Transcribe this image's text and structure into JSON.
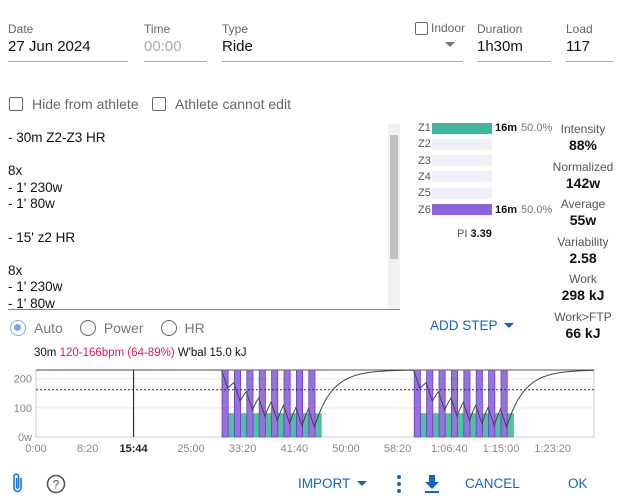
{
  "form": {
    "date": {
      "label": "Date",
      "value": "27 Jun 2024"
    },
    "time": {
      "label": "Time",
      "value": "00:00"
    },
    "type": {
      "label": "Type",
      "value": "Ride"
    },
    "indoor": {
      "label": "Indoor",
      "checked": false
    },
    "duration": {
      "label": "Duration",
      "value": "1h30m"
    },
    "load": {
      "label": "Load",
      "value": "117"
    },
    "hide_from_athlete": {
      "label": "Hide from athlete",
      "checked": false
    },
    "athlete_cannot_edit": {
      "label": "Athlete cannot edit",
      "checked": false
    }
  },
  "workout_text": [
    "- 30m Z2-Z3 HR",
    "",
    "8x",
    "- 1' 230w",
    "- 1' 80w",
    "",
    "- 15' z2 HR",
    "",
    "8x",
    "- 1' 230w",
    "- 1' 80w"
  ],
  "zones": [
    {
      "name": "Z1",
      "time": "16m",
      "pct": "50.0%",
      "fraction": 1.0,
      "color": "#3db89a"
    },
    {
      "name": "Z2",
      "time": "",
      "pct": "",
      "fraction": 0
    },
    {
      "name": "Z3",
      "time": "",
      "pct": "",
      "fraction": 0
    },
    {
      "name": "Z4",
      "time": "",
      "pct": "",
      "fraction": 0
    },
    {
      "name": "Z5",
      "time": "",
      "pct": "",
      "fraction": 0
    },
    {
      "name": "Z6",
      "time": "16m",
      "pct": "50.0%",
      "fraction": 1.0,
      "color": "#8a63d8"
    }
  ],
  "pi": {
    "label": "PI",
    "value": "3.39"
  },
  "stats": [
    {
      "label": "Intensity",
      "value": "88%"
    },
    {
      "label": "Normalized",
      "value": "142w"
    },
    {
      "label": "Average",
      "value": "55w"
    },
    {
      "label": "Variability",
      "value": "2.58"
    },
    {
      "label": "Work",
      "value": "298 kJ"
    },
    {
      "label": "Work>FTP",
      "value": "66 kJ"
    }
  ],
  "target_mode": {
    "options": [
      "Auto",
      "Power",
      "HR"
    ],
    "selected": "Auto"
  },
  "add_step_label": "ADD STEP",
  "chart_info": {
    "duration": "30m",
    "hr": "120-166bpm (64-89%)",
    "wbal": "W'bal 15.0 kJ"
  },
  "chart_data": {
    "type": "bar",
    "x_unit": "seconds",
    "xlim": [
      0,
      5400
    ],
    "ylim": [
      0,
      230
    ],
    "x_ticks": [
      "0:00",
      "8:20",
      "15:44",
      "25:00",
      "33:20",
      "41:40",
      "50:00",
      "58:20",
      "1:06:40",
      "1:15:00",
      "1:23:20"
    ],
    "x_tick_values": [
      0,
      500,
      944,
      1500,
      2000,
      2500,
      3000,
      3500,
      4000,
      4500,
      5000
    ],
    "cursor": 944,
    "y_ticks": [
      "0w",
      "100",
      "200"
    ],
    "y_tick_values": [
      0,
      100,
      200
    ],
    "threshold": 162,
    "wbal_max_kj": 15.0,
    "steps": [
      {
        "start": 0,
        "duration": 1800,
        "watts": null
      },
      {
        "repeat": 8,
        "start": 1800,
        "on": {
          "duration": 60,
          "watts": 230,
          "color": "#8a63d8"
        },
        "off": {
          "duration": 60,
          "watts": 80,
          "color": "#3db89a"
        }
      },
      {
        "start": 2760,
        "duration": 900,
        "watts": null
      },
      {
        "repeat": 8,
        "start": 3660,
        "on": {
          "duration": 60,
          "watts": 230,
          "color": "#8a63d8"
        },
        "off": {
          "duration": 60,
          "watts": 80,
          "color": "#3db89a"
        }
      },
      {
        "start": 4620,
        "duration": 780,
        "watts": null
      }
    ]
  },
  "footer": {
    "import_label": "IMPORT",
    "cancel_label": "CANCEL",
    "ok_label": "OK"
  },
  "icons": {
    "attach": "paperclip-icon",
    "help": "help-circle-icon",
    "more": "more-vert-icon",
    "download": "download-icon"
  }
}
